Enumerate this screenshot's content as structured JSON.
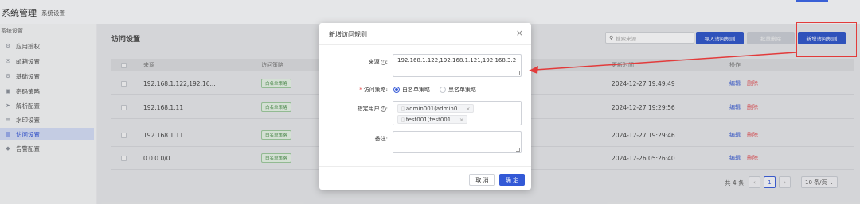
{
  "header": {
    "title": "系统管理",
    "separator": "/",
    "breadcrumb": "系统设置"
  },
  "sidebar": {
    "group_label": "系统设置",
    "items": [
      {
        "label": "应用授权",
        "icon": "gear-icon"
      },
      {
        "label": "邮箱设置",
        "icon": "mail-icon"
      },
      {
        "label": "基础设置",
        "icon": "gear-icon"
      },
      {
        "label": "密码策略",
        "icon": "lock-icon"
      },
      {
        "label": "解析配置",
        "icon": "send-icon"
      },
      {
        "label": "水印设置",
        "icon": "list-icon"
      },
      {
        "label": "访问设置",
        "icon": "doc-icon",
        "active": true
      },
      {
        "label": "告警配置",
        "icon": "bell-icon"
      }
    ]
  },
  "main": {
    "section_title": "访问设置",
    "search": {
      "placeholder": "搜索来源"
    },
    "buttons": {
      "import": "导入访问规则",
      "batch": "批量删除",
      "add": "新增访问规则"
    },
    "table": {
      "headers": {
        "source": "来源",
        "policy": "访问策略",
        "time": "更新时间",
        "action": "操作"
      },
      "rows": [
        {
          "source": "192.168.1.122,192.16...",
          "policy": "白名单策略",
          "time": "2024-12-27 19:49:49",
          "edit": "编辑",
          "delete": "删除"
        },
        {
          "source": "192.168.1.11",
          "policy": "白名单策略",
          "time": "2024-12-27 19:29:56",
          "edit": "编辑",
          "delete": "删除"
        },
        {
          "source": "192.168.1.11",
          "policy": "白名单策略",
          "time": "2024-12-27 19:29:46",
          "edit": "编辑",
          "delete": "删除"
        },
        {
          "source": "0.0.0.0/0",
          "policy": "白名单策略",
          "time": "2024-12-26 05:26:40",
          "edit": "编辑",
          "delete": "删除"
        }
      ]
    },
    "pagination": {
      "total": "共 4 条",
      "prev": "‹",
      "current": "1",
      "next": "›",
      "page_size": "10 条/页"
    }
  },
  "modal": {
    "title": "新增访问规则",
    "close": "×",
    "source_label": "来源",
    "source_value": "192.168.1.122,192.168.1.121,192.168.3.2",
    "policy_label": "访问策略",
    "policy_options": [
      {
        "label": "白名单策略",
        "selected": true
      },
      {
        "label": "黑名单策略",
        "selected": false
      }
    ],
    "users_label": "指定用户",
    "users": [
      "admin001(admin0...",
      "test001(test001..."
    ],
    "remark_label": "备注",
    "remark_value": "",
    "cancel": "取 消",
    "ok": "确 定"
  },
  "colors": {
    "primary": "#2f55c9",
    "annotation": "#e23b3b",
    "danger": "#e0474c",
    "success_tag": "#4c8f4c"
  }
}
